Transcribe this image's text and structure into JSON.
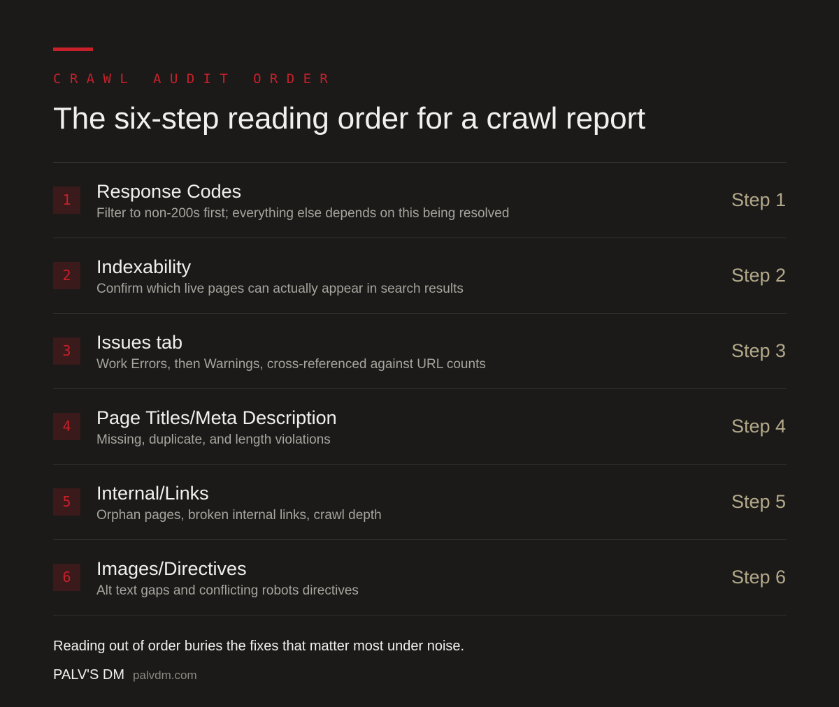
{
  "eyebrow": "CRAWL AUDIT ORDER",
  "title": "The six-step reading order for a crawl report",
  "steps": [
    {
      "number": "1",
      "name": "Response Codes",
      "description": "Filter to non-200s first; everything else depends on this being resolved",
      "label": "Step 1"
    },
    {
      "number": "2",
      "name": "Indexability",
      "description": "Confirm which live pages can actually appear in search results",
      "label": "Step 2"
    },
    {
      "number": "3",
      "name": "Issues tab",
      "description": "Work Errors, then Warnings, cross-referenced against URL counts",
      "label": "Step 3"
    },
    {
      "number": "4",
      "name": "Page Titles/Meta Description",
      "description": "Missing, duplicate, and length violations",
      "label": "Step 4"
    },
    {
      "number": "5",
      "name": "Internal/Links",
      "description": "Orphan pages, broken internal links, crawl depth",
      "label": "Step 5"
    },
    {
      "number": "6",
      "name": "Images/Directives",
      "description": "Alt text gaps and conflicting robots directives",
      "label": "Step 6"
    }
  ],
  "footer": {
    "note": "Reading out of order buries the fixes that matter most under noise.",
    "brand_name": "PALV'S DM",
    "brand_url": "palvdm.com"
  },
  "colors": {
    "background": "#1b1a19",
    "accent": "#c8202a",
    "step_label": "#b3a98a"
  }
}
